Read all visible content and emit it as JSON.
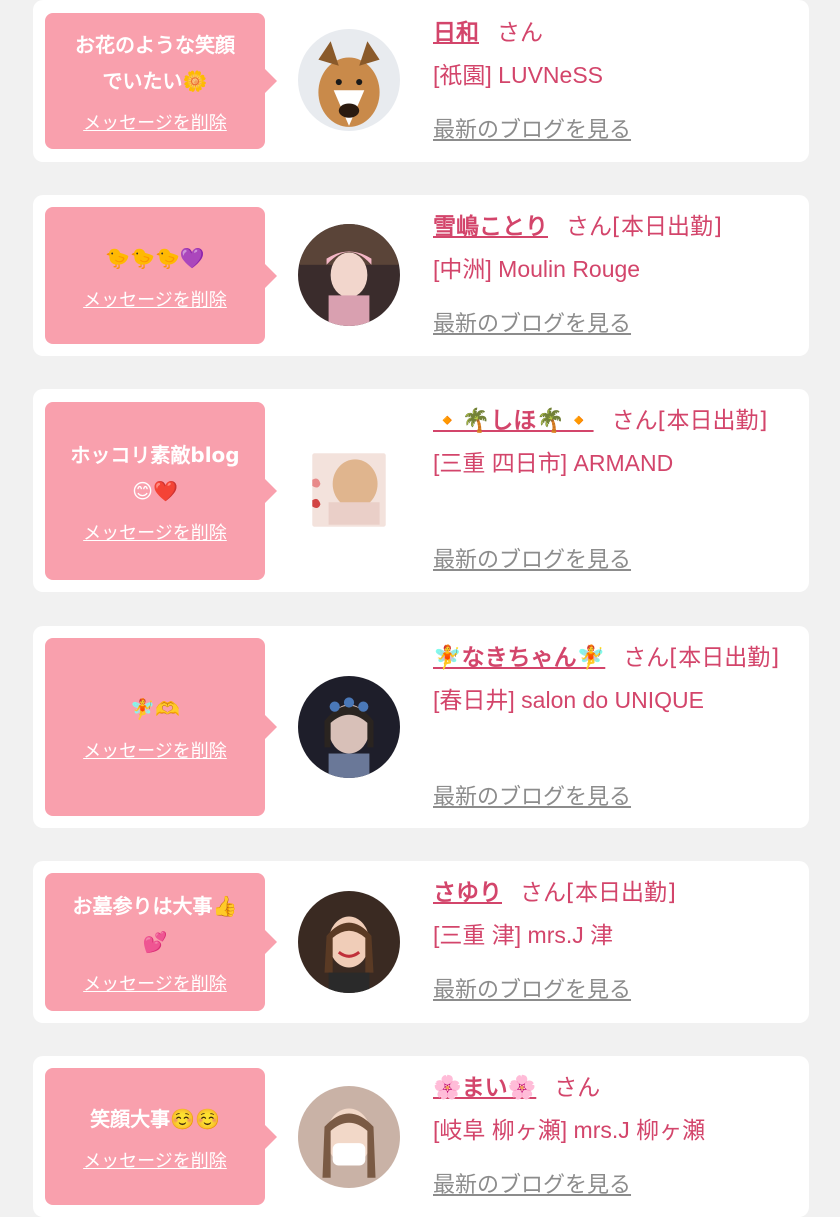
{
  "colors": {
    "bubble": "#f9a0ad",
    "accent": "#d3456b",
    "link_gray": "#8c8c8c",
    "background": "#f1f1f1"
  },
  "cards": [
    {
      "message": "お花のような笑顔\nでいたい🌼",
      "delete_label": "メッセージを削除",
      "name": "日和",
      "suffix": "さん",
      "shop": "[祇園] LUVNeSS",
      "blog_label": "最新のブログを見る",
      "avatar_icon": "dog-avatar"
    },
    {
      "message": "🐤🐤🐤💜",
      "delete_label": "メッセージを削除",
      "name": "雪嶋ことり",
      "suffix": "さん[本日出勤]",
      "shop": "[中洲] Moulin Rouge",
      "blog_label": "最新のブログを見る",
      "avatar_icon": "person-avatar"
    },
    {
      "message": "ホッコリ素敵blog\n😊❤️",
      "delete_label": "メッセージを削除",
      "name": "🔸🌴しほ🌴🔸",
      "suffix": "さん[本日出勤]",
      "shop": "[三重 四日市] ARMAND",
      "blog_label": "最新のブログを見る",
      "avatar_icon": "person-avatar"
    },
    {
      "message": "🧚🫶",
      "delete_label": "メッセージを削除",
      "name": "🧚なきちゃん🧚",
      "suffix": "さん[本日出勤]",
      "shop": "[春日井] salon do UNIQUE",
      "blog_label": "最新のブログを見る",
      "avatar_icon": "person-avatar"
    },
    {
      "message": "お墓参りは大事👍\n💕",
      "delete_label": "メッセージを削除",
      "name": "さゆり",
      "suffix": "さん[本日出勤]",
      "shop": "[三重 津] mrs.J 津",
      "blog_label": "最新のブログを見る",
      "avatar_icon": "person-avatar"
    },
    {
      "message": "笑顔大事☺️☺️",
      "delete_label": "メッセージを削除",
      "name": "🌸まい🌸",
      "suffix": "さん",
      "shop": "[岐阜 柳ヶ瀬] mrs.J 柳ヶ瀬",
      "blog_label": "最新のブログを見る",
      "avatar_icon": "person-avatar"
    }
  ]
}
